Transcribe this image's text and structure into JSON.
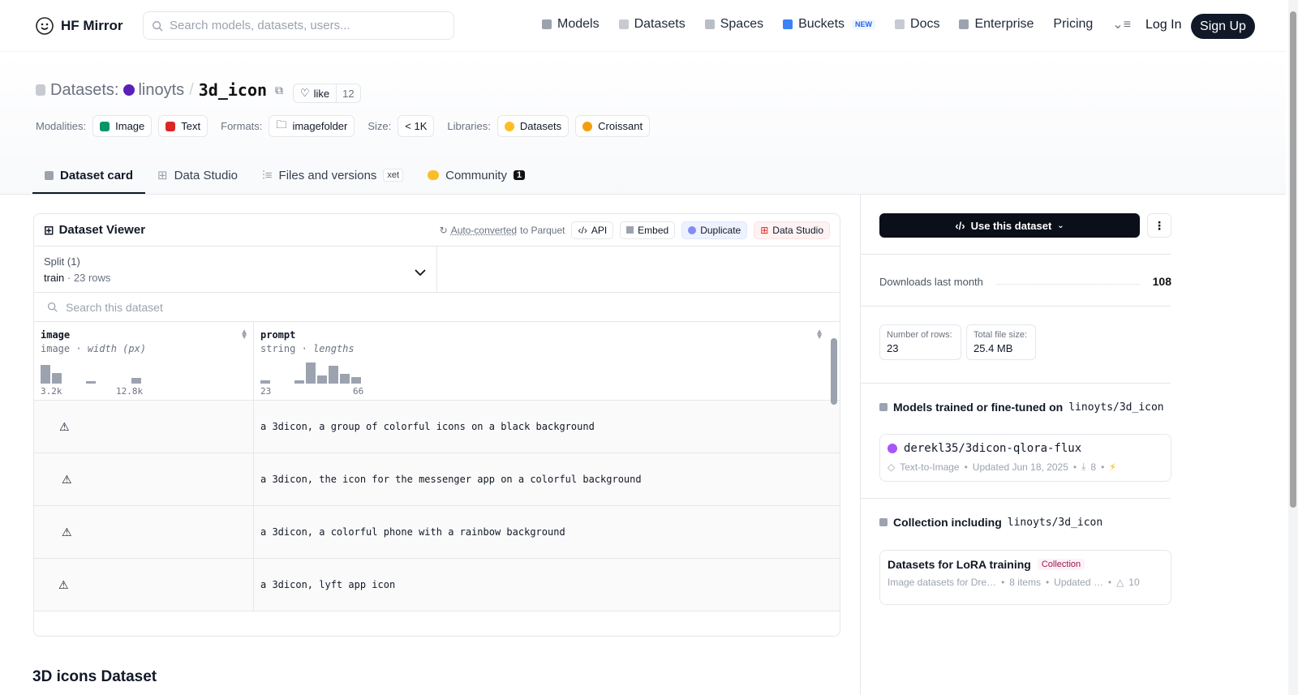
{
  "nav": {
    "brand": "HF Mirror",
    "search_placeholder": "Search models, datasets, users...",
    "links": [
      {
        "label": "Models",
        "icon": "model-icon"
      },
      {
        "label": "Datasets",
        "icon": "dataset-icon"
      },
      {
        "label": "Spaces",
        "icon": "spaces-icon"
      },
      {
        "label": "Buckets",
        "icon": "bucket-icon",
        "badge": "NEW"
      },
      {
        "label": "Docs",
        "icon": "docs-icon"
      },
      {
        "label": "Enterprise",
        "icon": "enterprise-icon"
      },
      {
        "label": "Pricing"
      }
    ],
    "login": "Log In",
    "signup": "Sign Up"
  },
  "header": {
    "section": "Datasets:",
    "user": "linoyts",
    "separator": "/",
    "repo": "3d_icon",
    "like_label": "like",
    "like_count": "12",
    "modalities_label": "Modalities:",
    "modalities": [
      "Image",
      "Text"
    ],
    "formats_label": "Formats:",
    "format": "imagefolder",
    "size_label": "Size:",
    "size": "< 1K",
    "libraries_label": "Libraries:",
    "libraries": [
      "Datasets",
      "Croissant"
    ]
  },
  "tabs": [
    {
      "label": "Dataset card",
      "active": true
    },
    {
      "label": "Data Studio"
    },
    {
      "label": "Files and versions",
      "badge": "xet"
    },
    {
      "label": "Community",
      "count": "1"
    }
  ],
  "viewer": {
    "title": "Dataset Viewer",
    "auto_converted": "Auto-converted",
    "to_parquet": "to Parquet",
    "buttons": [
      "API",
      "Embed",
      "Duplicate",
      "Data Studio"
    ],
    "split_label": "Split (1)",
    "split_value": "train",
    "split_rows": "23 rows",
    "search_placeholder": "Search this dataset",
    "columns": [
      {
        "name": "image",
        "type": "image",
        "stat": "width (px)",
        "min": "3.2k",
        "max": "12.8k",
        "hist": [
          0.9,
          0.5,
          0,
          0,
          0.1,
          0,
          0,
          0,
          0.25
        ]
      },
      {
        "name": "prompt",
        "type": "string",
        "stat": "lengths",
        "min": "23",
        "max": "66",
        "hist": [
          0.15,
          0,
          0,
          0.15,
          1.0,
          0.4,
          0.85,
          0.45,
          0.3
        ]
      }
    ],
    "rows": [
      "a 3dicon, a group of colorful icons on a black background",
      "a 3dicon, the icon for the messenger app on a colorful background",
      "a 3dicon, a colorful phone with a rainbow background",
      "a 3dicon, lyft app icon"
    ]
  },
  "section_title": "3D icons Dataset",
  "sidebar": {
    "use_label": "Use this dataset",
    "downloads_label": "Downloads last month",
    "downloads": "108",
    "rows_label": "Number of rows:",
    "rows": "23",
    "size_label": "Total file size:",
    "size": "25.4 MB",
    "models_heading": "Models trained or fine-tuned on",
    "repo_ref": "linoyts/3d_icon",
    "model": {
      "name": "derekl35/3dicon-qlora-flux",
      "task": "Text-to-Image",
      "updated": "Updated Jun 18, 2025",
      "downloads": "8"
    },
    "collection_heading": "Collection including",
    "collection": {
      "name": "Datasets for LoRA training",
      "badge": "Collection",
      "desc": "Image datasets for Dre…",
      "items": "8 items",
      "updated": "Updated …",
      "upvotes": "10"
    }
  },
  "colors": {
    "accent_dark": "#0b0f19",
    "purple": "#a855f7",
    "like_border": "#e5e7eb"
  }
}
